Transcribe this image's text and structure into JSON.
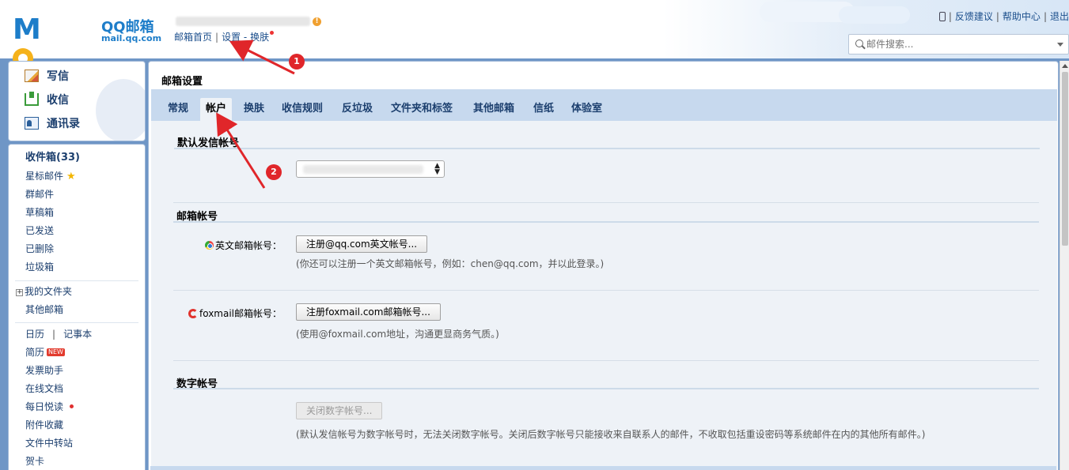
{
  "header": {
    "logo": {
      "mark": "MOil",
      "product": "QQ邮箱",
      "domain": "mail.qq.com"
    },
    "nav_links": {
      "home": "邮箱首页",
      "settings": "设置",
      "dash": "-",
      "skin": "换肤"
    },
    "top_links": {
      "feedback": "反馈建议",
      "help": "帮助中心",
      "logout": "退出"
    },
    "search": {
      "placeholder": "邮件搜索..."
    }
  },
  "sidebar": {
    "quick": {
      "write": "写信",
      "receive": "收信",
      "contacts": "通讯录"
    },
    "items": {
      "inbox": "收件箱(33)",
      "starred": "星标邮件",
      "group": "群邮件",
      "drafts": "草稿箱",
      "sent": "已发送",
      "deleted": "已删除",
      "trash": "垃圾箱",
      "my_folders": "我的文件夹",
      "other_mail": "其他邮箱",
      "calendar": "日历",
      "cal_sep": "|",
      "notepad": "记事本",
      "resume": "简历",
      "resume_badge": "NEW",
      "invoice": "发票助手",
      "online_docs": "在线文档",
      "daily_read": "每日悦读",
      "attachments": "附件收藏",
      "file_transfer": "文件中转站",
      "cards": "贺卡"
    }
  },
  "main": {
    "title": "邮箱设置",
    "tabs": [
      "常规",
      "帐户",
      "换肤",
      "收信规则",
      "反垃圾",
      "文件夹和标签",
      "其他邮箱",
      "信纸",
      "体验室"
    ],
    "active_tab": "帐户",
    "sections": {
      "default_sender": {
        "title": "默认发信帐号"
      },
      "mail_accounts": {
        "title": "邮箱帐号",
        "english": {
          "label": "英文邮箱帐号：",
          "button": "注册@qq.com英文帐号...",
          "hint": "(你还可以注册一个英文邮箱帐号，例如：chen@qq.com，并以此登录。)"
        },
        "foxmail": {
          "label": "foxmail邮箱帐号：",
          "button": "注册foxmail.com邮箱帐号...",
          "hint": "(使用@foxmail.com地址，沟通更显商务气质。)"
        }
      },
      "digital_account": {
        "title": "数字帐号",
        "button": "关闭数字帐号...",
        "hint": "(默认发信帐号为数字帐号时，无法关闭数字帐号。关闭后数字帐号只能接收来自联系人的邮件，不收取包括重设密码等系统邮件在内的其他所有邮件。)"
      }
    }
  },
  "annotations": {
    "badge1": "1",
    "badge2": "2",
    "color": "#e0262a"
  }
}
